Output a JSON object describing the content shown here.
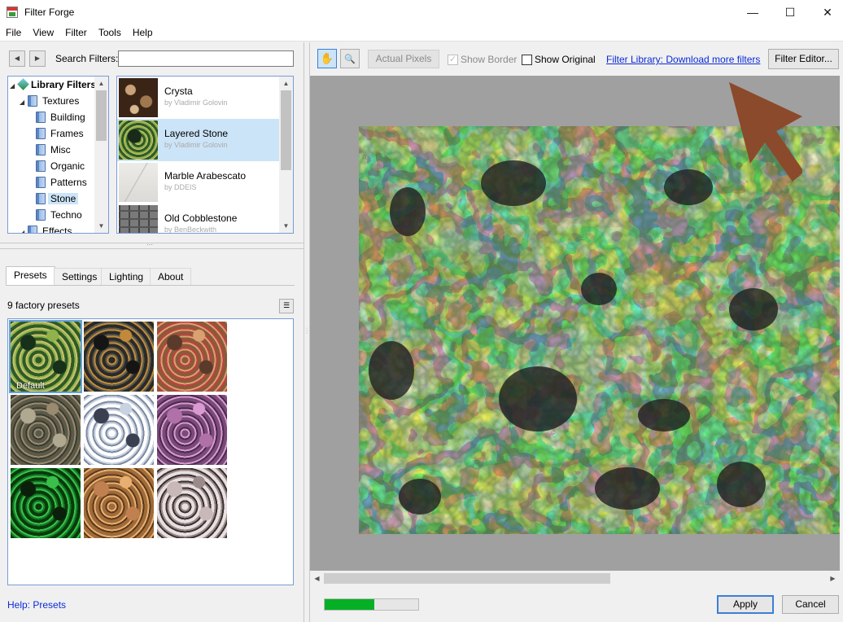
{
  "window": {
    "title": "Filter Forge",
    "minimize": "—",
    "maximize": "☐",
    "close": "✕"
  },
  "menu": [
    "File",
    "View",
    "Filter",
    "Tools",
    "Help"
  ],
  "search": {
    "label": "Search Filters:",
    "value": "",
    "back": "◀",
    "forward": "▶"
  },
  "tree": {
    "root": "Library Filters",
    "items": [
      {
        "label": "Textures",
        "selected": false
      },
      {
        "label": "Building",
        "selected": false
      },
      {
        "label": "Frames",
        "selected": false
      },
      {
        "label": "Misc",
        "selected": false
      },
      {
        "label": "Organic",
        "selected": false
      },
      {
        "label": "Patterns",
        "selected": false
      },
      {
        "label": "Stone",
        "selected": true
      },
      {
        "label": "Techno",
        "selected": false
      },
      {
        "label": "Effects",
        "selected": false
      }
    ]
  },
  "filters": [
    {
      "name": "Crysta",
      "author": "by Vladimir Golovin",
      "selected": false
    },
    {
      "name": "Layered Stone",
      "author": "by Vladimir Golovin",
      "selected": true
    },
    {
      "name": "Marble Arabescato",
      "author": "by DDEIS",
      "selected": false
    },
    {
      "name": "Old Cobblestone",
      "author": "by BenBeckwith",
      "selected": false
    }
  ],
  "tabs": [
    "Presets",
    "Settings",
    "Lighting",
    "About"
  ],
  "active_tab": "Presets",
  "presets": {
    "count_label": "9 factory presets",
    "items": [
      {
        "label": "Default",
        "colors": [
          "#2f5a26",
          "#8fb24a",
          "#c8c070",
          "#17301a"
        ]
      },
      {
        "label": "",
        "colors": [
          "#2a2a28",
          "#c08a3a",
          "#5a5a50",
          "#151515"
        ]
      },
      {
        "label": "",
        "colors": [
          "#8a5a3a",
          "#d9a070",
          "#c04040",
          "#5a3a2a"
        ]
      },
      {
        "label": "",
        "colors": [
          "#5a5a48",
          "#9a8a70",
          "#3a3a30",
          "#b0a890"
        ]
      },
      {
        "label": "",
        "colors": [
          "#ffffff",
          "#c8d2e0",
          "#7d8aa0",
          "#3a4050"
        ]
      },
      {
        "label": "",
        "colors": [
          "#7a4a7a",
          "#d89ad0",
          "#4a2a4a",
          "#b070a8"
        ]
      },
      {
        "label": "",
        "colors": [
          "#0a3a0a",
          "#3ac04a",
          "#127a2a",
          "#0a200a"
        ]
      },
      {
        "label": "",
        "colors": [
          "#a06a3a",
          "#e8b070",
          "#5a3a1a",
          "#c08050"
        ]
      },
      {
        "label": "",
        "colors": [
          "#e8e0e0",
          "#9a8a8a",
          "#3a3030",
          "#c8b8b8"
        ]
      }
    ]
  },
  "help_link": "Help: Presets",
  "toolbar": {
    "hand_icon": "✋",
    "zoom_icon": "🔍",
    "actual_pixels": "Actual Pixels",
    "show_border": "Show Border",
    "show_border_checked": true,
    "show_original": "Show Original",
    "show_original_checked": false,
    "library_link": "Filter Library: Download more filters",
    "filter_editor": "Filter Editor..."
  },
  "progress": {
    "fraction": 0.53
  },
  "buttons": {
    "apply": "Apply",
    "cancel": "Cancel"
  },
  "colors": {
    "accent": "#3b7fd6",
    "link": "#0b2bd8",
    "arrow": "#8b4a2b",
    "canvas_bg": "#a0a0a0",
    "progress": "#06b025"
  }
}
